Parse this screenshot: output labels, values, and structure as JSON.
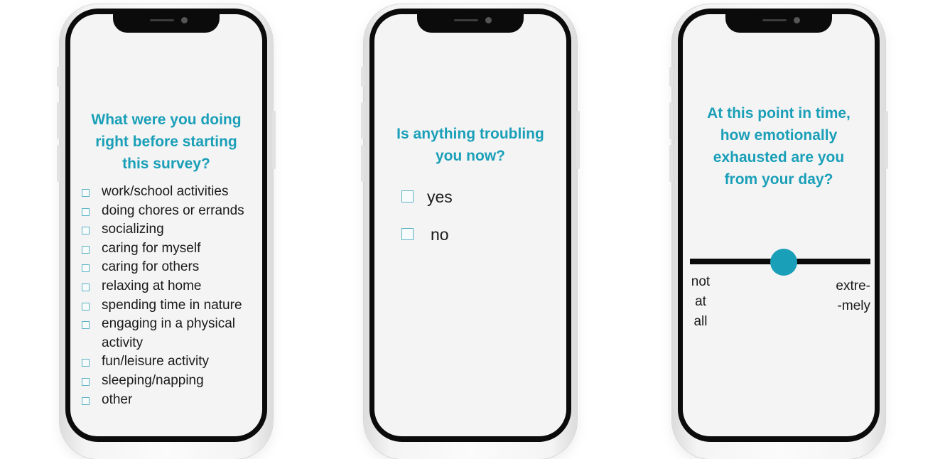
{
  "accent_color": "#1a9fb8",
  "screens": [
    {
      "question": [
        "What were you doing",
        "right before starting",
        "this survey?"
      ],
      "options": [
        "work/school activities",
        "doing chores or errands",
        "socializing",
        "caring for myself",
        "caring for others",
        "relaxing at home",
        "spending time in nature",
        [
          "engaging in a physical",
          "activity"
        ],
        "fun/leisure activity",
        "sleeping/napping",
        "other"
      ]
    },
    {
      "question": [
        "Is anything troubling",
        "you now?"
      ],
      "options": [
        "yes",
        "no"
      ]
    },
    {
      "question": [
        "At this point in time,",
        "how emotionally",
        "exhausted are you",
        "from your day?"
      ],
      "slider": {
        "value": 0.52,
        "low_label": [
          "not",
          "at",
          "all"
        ],
        "high_label": [
          "extre-",
          "-mely"
        ]
      }
    }
  ]
}
